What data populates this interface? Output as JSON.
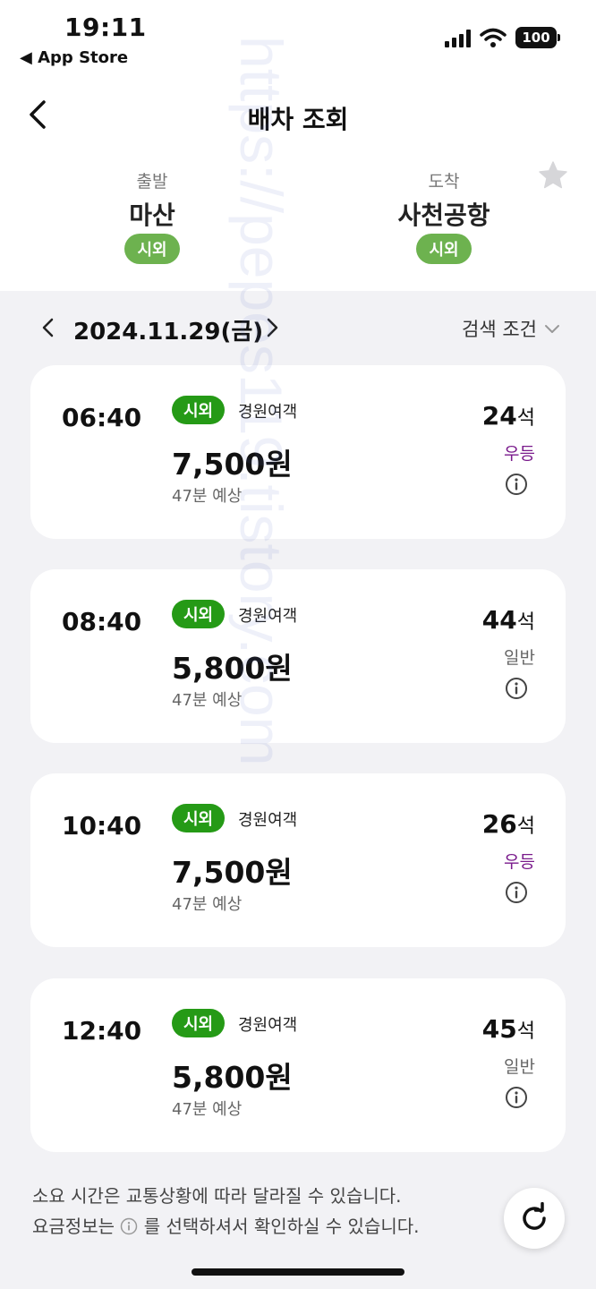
{
  "status_bar": {
    "time": "19:11",
    "back_app": "◀ App Store",
    "battery": "100"
  },
  "nav": {
    "title": "배차 조회"
  },
  "route": {
    "departure": {
      "label": "출발",
      "name": "마산",
      "badge": "시외"
    },
    "arrival": {
      "label": "도착",
      "name": "사천공항",
      "badge": "시외"
    }
  },
  "date_bar": {
    "date": "2024.11.29(금)",
    "search_condition": "검색 조건"
  },
  "schedules": [
    {
      "time": "06:40",
      "tag": "시외",
      "operator": "경원여객",
      "fare": "7,500원",
      "duration": "47분 예상",
      "seats": "24",
      "seat_unit": "석",
      "grade": "우등"
    },
    {
      "time": "08:40",
      "tag": "시외",
      "operator": "경원여객",
      "fare": "5,800원",
      "duration": "47분 예상",
      "seats": "44",
      "seat_unit": "석",
      "grade": "일반"
    },
    {
      "time": "10:40",
      "tag": "시외",
      "operator": "경원여객",
      "fare": "7,500원",
      "duration": "47분 예상",
      "seats": "26",
      "seat_unit": "석",
      "grade": "우등"
    },
    {
      "time": "12:40",
      "tag": "시외",
      "operator": "경원여객",
      "fare": "5,800원",
      "duration": "47분 예상",
      "seats": "45",
      "seat_unit": "석",
      "grade": "일반"
    }
  ],
  "footer": {
    "note1": "소요 시간은 교통상황에 따라 달라질 수 있습니다.",
    "note2_before": "요금정보는",
    "note2_after": "를 선택하셔서 확인하실 수 있습니다."
  },
  "watermark": "https://pepes119.tistory.com",
  "colors": {
    "badge_light_green": "#6db24f",
    "tag_green": "#259a16",
    "premium_purple": "#7a1b8c",
    "page_background": "#f2f2f5"
  }
}
